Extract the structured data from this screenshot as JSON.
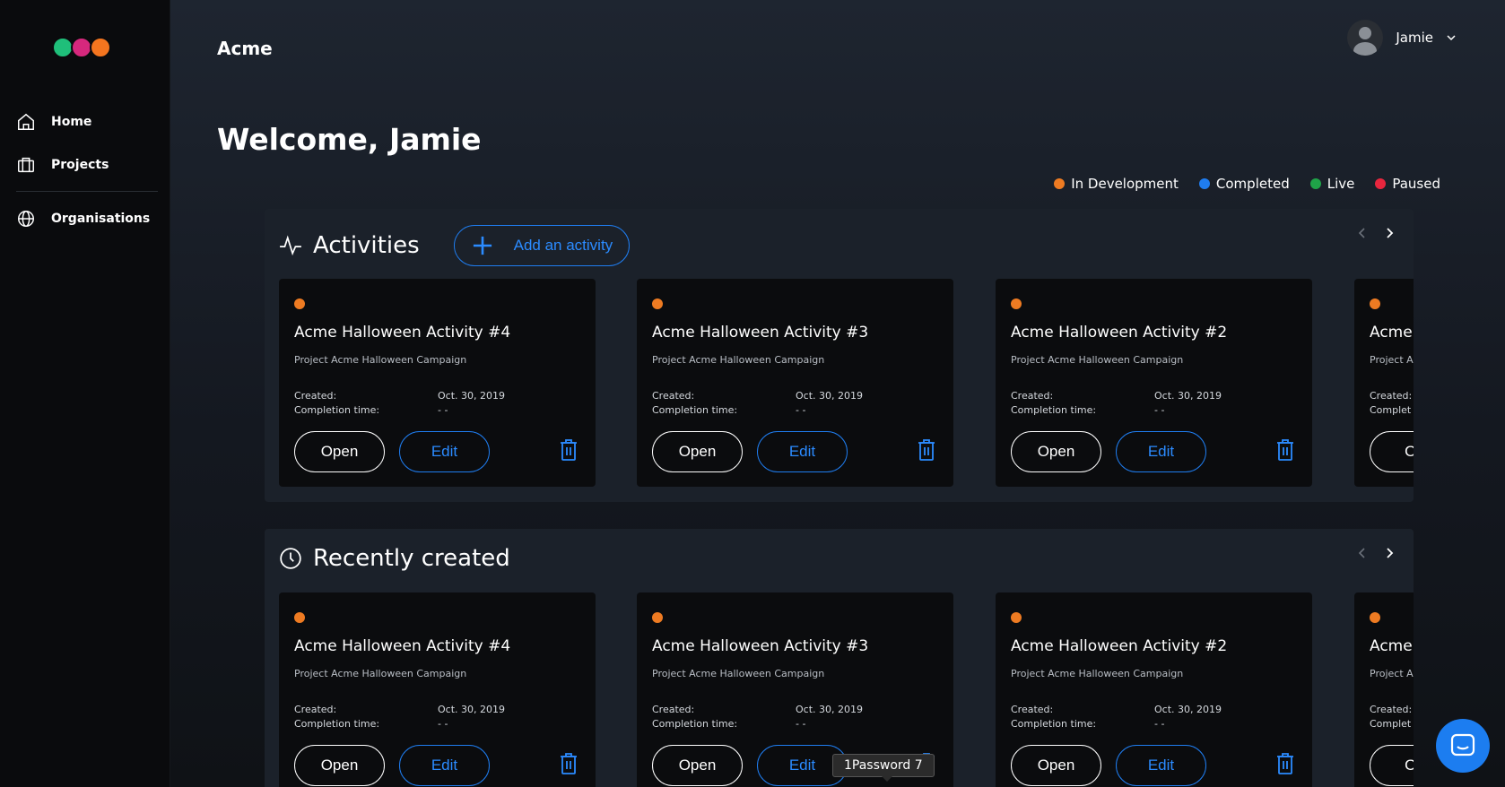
{
  "app": {
    "title": "Acme"
  },
  "colors": {
    "accent": "#2b8bff",
    "in_development": "#ee7b22",
    "completed": "#1f7df0",
    "live": "#1fa348",
    "paused": "#e8263e"
  },
  "sidebar": {
    "items": [
      {
        "label": "Home",
        "icon": "home-icon"
      },
      {
        "label": "Projects",
        "icon": "briefcase-icon"
      },
      {
        "label": "Organisations",
        "icon": "globe-icon"
      }
    ]
  },
  "user": {
    "name": "Jamie"
  },
  "welcome": "Welcome, Jamie",
  "legend": [
    {
      "label": "In Development",
      "color": "#ee7b22"
    },
    {
      "label": "Completed",
      "color": "#1f7df0"
    },
    {
      "label": "Live",
      "color": "#1fa348"
    },
    {
      "label": "Paused",
      "color": "#e8263e"
    }
  ],
  "activities": {
    "title": "Activities",
    "add_label": "Add an activity",
    "cards": [
      {
        "title": "Acme Halloween Activity #4",
        "project": "Project Acme Halloween Campaign",
        "created_label": "Created:",
        "created": "Oct. 30, 2019",
        "completion_label": "Completion time:",
        "completion": "- -",
        "open": "Open",
        "edit": "Edit",
        "status": "In Development"
      },
      {
        "title": "Acme Halloween Activity #3",
        "project": "Project Acme Halloween Campaign",
        "created_label": "Created:",
        "created": "Oct. 30, 2019",
        "completion_label": "Completion time:",
        "completion": "- -",
        "open": "Open",
        "edit": "Edit",
        "status": "In Development"
      },
      {
        "title": "Acme Halloween Activity #2",
        "project": "Project Acme Halloween Campaign",
        "created_label": "Created:",
        "created": "Oct. 30, 2019",
        "completion_label": "Completion time:",
        "completion": "- -",
        "open": "Open",
        "edit": "Edit",
        "status": "In Development"
      },
      {
        "title": "Acme",
        "project": "Project A",
        "created_label": "Created:",
        "created": "",
        "completion_label": "Complet",
        "completion": "",
        "open": "Op",
        "edit": "",
        "status": "In Development"
      }
    ]
  },
  "recent": {
    "title": "Recently created",
    "cards": [
      {
        "title": "Acme Halloween Activity #4",
        "project": "Project Acme Halloween Campaign",
        "created_label": "Created:",
        "created": "Oct. 30, 2019",
        "completion_label": "Completion time:",
        "completion": "- -",
        "open": "Open",
        "edit": "Edit",
        "status": "In Development"
      },
      {
        "title": "Acme Halloween Activity #3",
        "project": "Project Acme Halloween Campaign",
        "created_label": "Created:",
        "created": "Oct. 30, 2019",
        "completion_label": "Completion time:",
        "completion": "- -",
        "open": "Open",
        "edit": "Edit",
        "status": "In Development"
      },
      {
        "title": "Acme Halloween Activity #2",
        "project": "Project Acme Halloween Campaign",
        "created_label": "Created:",
        "created": "Oct. 30, 2019",
        "completion_label": "Completion time:",
        "completion": "- -",
        "open": "Open",
        "edit": "Edit",
        "status": "In Development"
      },
      {
        "title": "Acme",
        "project": "Project A",
        "created_label": "Created:",
        "created": "",
        "completion_label": "Complet",
        "completion": "",
        "open": "Op",
        "edit": "",
        "status": "In Development"
      }
    ]
  },
  "tooltip": "1Password 7"
}
